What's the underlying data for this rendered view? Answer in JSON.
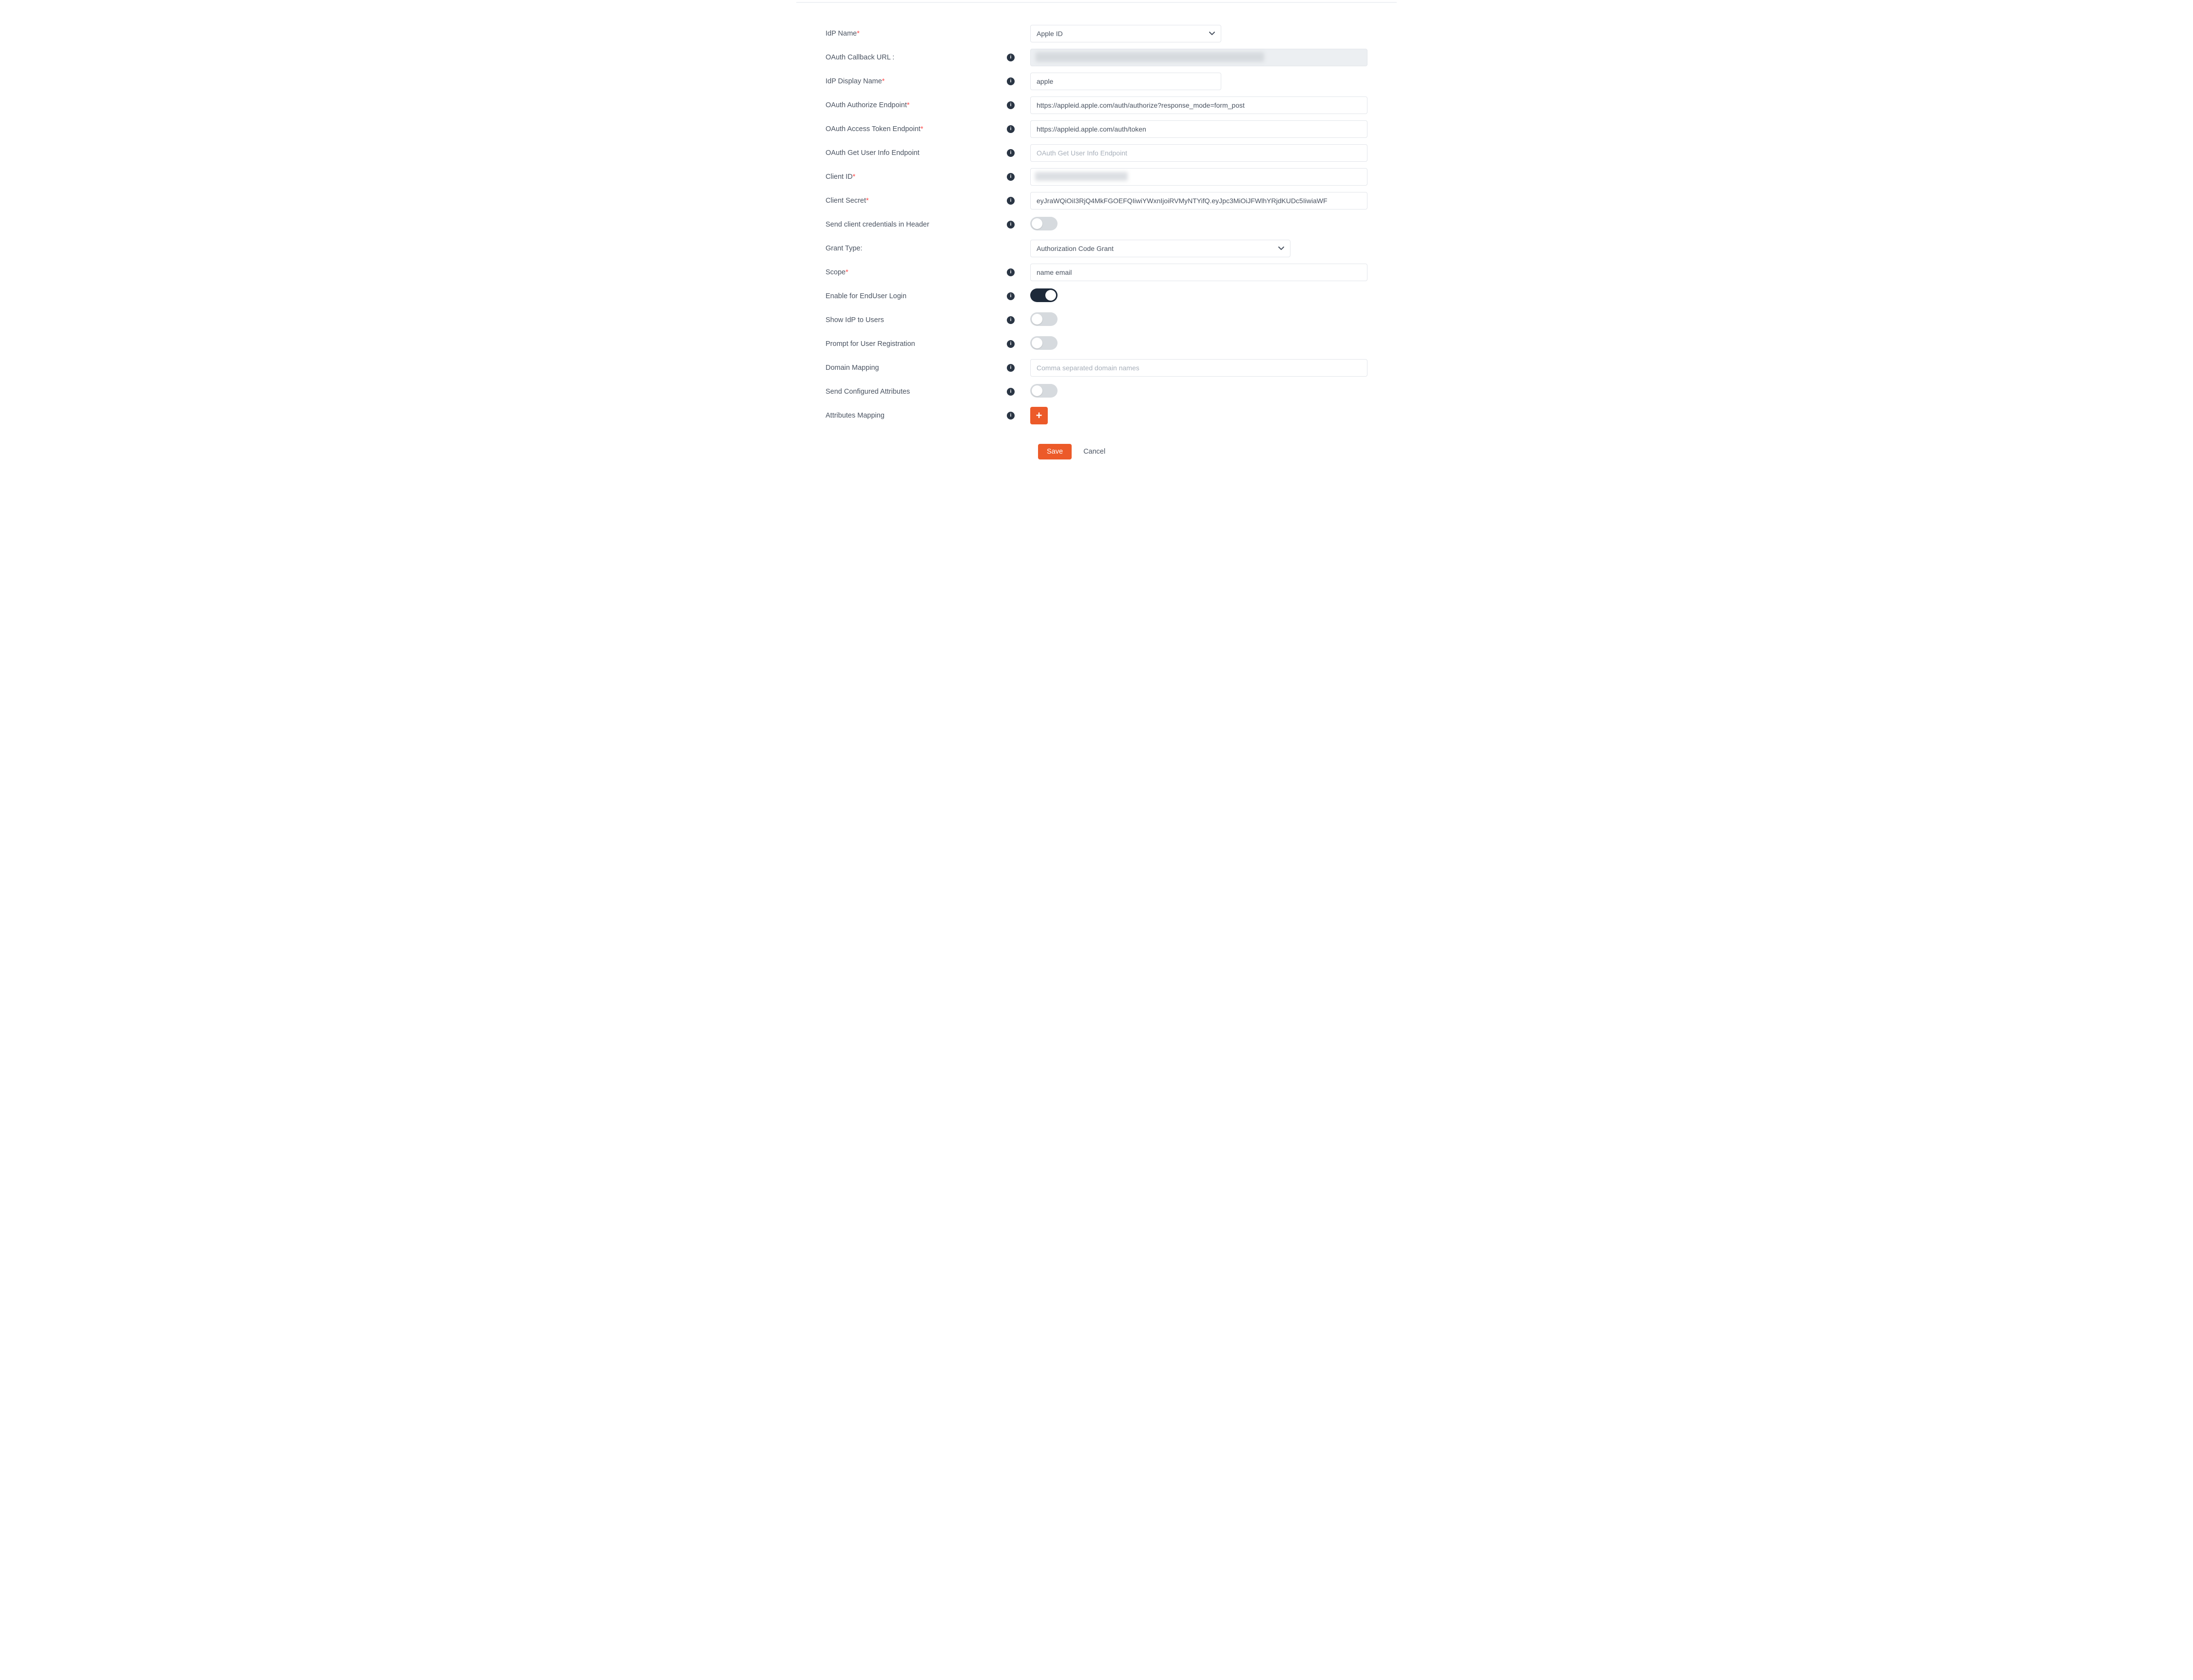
{
  "labels": {
    "idp_name": "IdP Name",
    "callback": "OAuth Callback URL :",
    "display_name": "IdP Display Name",
    "authorize_ep": "OAuth Authorize Endpoint",
    "token_ep": "OAuth Access Token Endpoint",
    "userinfo_ep": "OAuth Get User Info Endpoint",
    "client_id": "Client ID",
    "client_secret": "Client Secret",
    "send_header": "Send client credentials in Header",
    "grant_type": "Grant Type:",
    "scope": "Scope",
    "enable_enduser": "Enable for EndUser Login",
    "show_idp": "Show IdP to Users",
    "prompt_reg": "Prompt for User Registration",
    "domain_mapping": "Domain Mapping",
    "send_attrs": "Send Configured Attributes",
    "attr_mapping": "Attributes Mapping"
  },
  "values": {
    "idp_name": "Apple ID",
    "display_name": "apple",
    "authorize_ep": "https://appleid.apple.com/auth/authorize?response_mode=form_post",
    "token_ep": "https://appleid.apple.com/auth/token",
    "client_secret": "eyJraWQiOiI3RjQ4MkFGOEFQIiwiYWxnIjoiRVMyNTYifQ.eyJpc3MiOiJFWlhYRjdKUDc5IiwiaWF",
    "grant_type": "Authorization Code Grant",
    "scope": "name email"
  },
  "placeholders": {
    "userinfo": "OAuth Get User Info Endpoint",
    "domain_mapping": "Comma separated domain names"
  },
  "toggles": {
    "send_header": false,
    "enable_enduser": true,
    "show_idp": false,
    "prompt_reg": false,
    "send_attrs": false
  },
  "buttons": {
    "save": "Save",
    "cancel": "Cancel",
    "add": "+"
  },
  "icons": {
    "info_glyph": "i"
  }
}
